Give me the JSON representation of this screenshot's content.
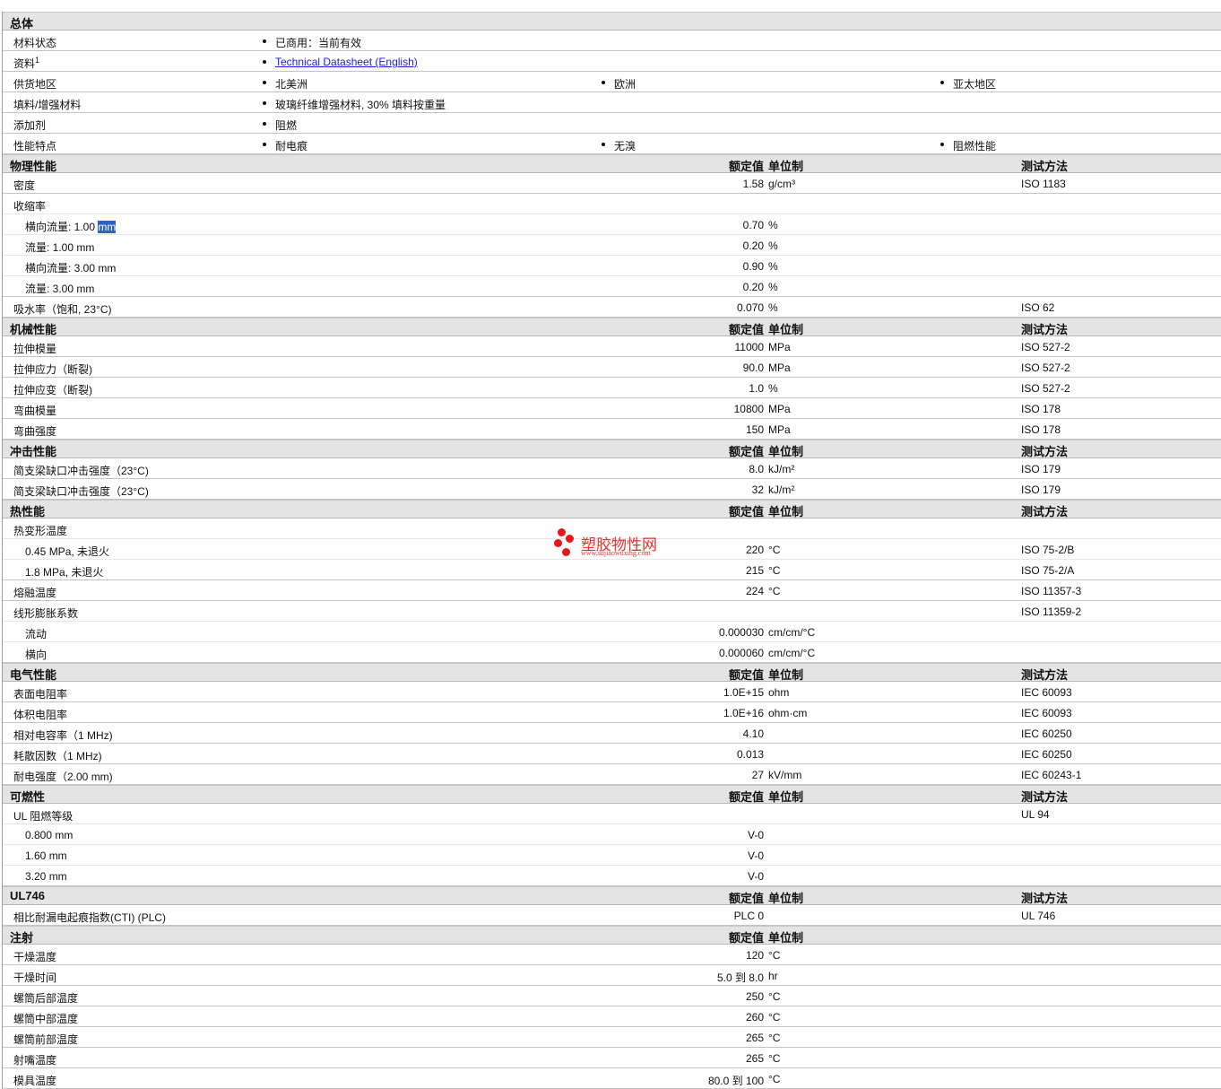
{
  "columns": {
    "value": "额定值",
    "unit": "单位制",
    "method": "测试方法"
  },
  "general": {
    "title": "总体",
    "rows": [
      {
        "label": "材料状态",
        "items": [
          "已商用：当前有效"
        ]
      },
      {
        "label": "资料",
        "sup": "1",
        "items": [
          "Technical Datasheet (English)"
        ],
        "link": true
      },
      {
        "label": "供货地区",
        "items": [
          "北美洲",
          "欧洲",
          "亚太地区"
        ]
      },
      {
        "label": "填料/增强材料",
        "items": [
          "玻璃纤维增强材料, 30% 填料按重量"
        ]
      },
      {
        "label": "添加剂",
        "items": [
          "阻燃"
        ]
      },
      {
        "label": "性能特点",
        "items": [
          "耐电痕",
          "无溴",
          "阻燃性能"
        ]
      }
    ]
  },
  "sections": [
    {
      "title": "物理性能",
      "method_header": true,
      "rows": [
        {
          "label": "密度",
          "value": "1.58",
          "unit": "g/cm³",
          "method": "ISO 1183"
        },
        {
          "label": "收缩率",
          "value": "",
          "unit": "",
          "method": "",
          "parent": true
        },
        {
          "label": "横向流量: 1.00 ",
          "hl": "mm",
          "value": "0.70",
          "unit": "%",
          "method": "",
          "indent": true
        },
        {
          "label": "流量: 1.00 mm",
          "value": "0.20",
          "unit": "%",
          "method": "",
          "indent": true
        },
        {
          "label": "横向流量: 3.00 mm",
          "value": "0.90",
          "unit": "%",
          "method": "",
          "indent": true
        },
        {
          "label": "流量: 3.00 mm",
          "value": "0.20",
          "unit": "%",
          "method": "",
          "indent": true,
          "last": true
        },
        {
          "label": "吸水率（饱和, 23°C)",
          "value": "0.070",
          "unit": "%",
          "method": "ISO 62"
        }
      ]
    },
    {
      "title": "机械性能",
      "method_header": true,
      "rows": [
        {
          "label": "拉伸模量",
          "value": "11000",
          "unit": "MPa",
          "method": "ISO 527-2"
        },
        {
          "label": "拉伸应力（断裂)",
          "value": "90.0",
          "unit": "MPa",
          "method": "ISO 527-2"
        },
        {
          "label": "拉伸应变（断裂)",
          "value": "1.0",
          "unit": "%",
          "method": "ISO 527-2"
        },
        {
          "label": "弯曲模量",
          "value": "10800",
          "unit": "MPa",
          "method": "ISO 178"
        },
        {
          "label": "弯曲强度",
          "value": "150",
          "unit": "MPa",
          "method": "ISO 178"
        }
      ]
    },
    {
      "title": "冲击性能",
      "method_header": true,
      "rows": [
        {
          "label": "简支梁缺口冲击强度（23°C)",
          "value": "8.0",
          "unit": "kJ/m²",
          "method": "ISO 179"
        },
        {
          "label": "简支梁缺口冲击强度（23°C)",
          "value": "32",
          "unit": "kJ/m²",
          "method": "ISO 179"
        }
      ]
    },
    {
      "title": "热性能",
      "method_header": true,
      "rows": [
        {
          "label": "热变形温度",
          "value": "",
          "unit": "",
          "method": "",
          "parent": true
        },
        {
          "label": "0.45 MPa, 未退火",
          "value": "220",
          "unit": "°C",
          "method": "ISO 75-2/B",
          "indent": true
        },
        {
          "label": "1.8 MPa, 未退火",
          "value": "215",
          "unit": "°C",
          "method": "ISO 75-2/A",
          "indent": true,
          "last": true
        },
        {
          "label": "熔融温度",
          "value": "224",
          "unit": "°C",
          "method": "ISO 11357-3"
        },
        {
          "label": "线形膨胀系数",
          "value": "",
          "unit": "",
          "method": "ISO 11359-2",
          "parent": true
        },
        {
          "label": "流动",
          "value": "0.000030",
          "unit": "cm/cm/°C",
          "method": "",
          "indent": true
        },
        {
          "label": "横向",
          "value": "0.000060",
          "unit": "cm/cm/°C",
          "method": "",
          "indent": true,
          "last": true
        }
      ]
    },
    {
      "title": "电气性能",
      "method_header": true,
      "rows": [
        {
          "label": "表面电阻率",
          "value": "1.0E+15",
          "unit": "ohm",
          "method": "IEC 60093"
        },
        {
          "label": "体积电阻率",
          "value": "1.0E+16",
          "unit": "ohm·cm",
          "method": "IEC 60093"
        },
        {
          "label": "相对电容率（1 MHz)",
          "value": "4.10",
          "unit": "",
          "method": "IEC 60250"
        },
        {
          "label": "耗散因数（1 MHz)",
          "value": "0.013",
          "unit": "",
          "method": "IEC 60250"
        },
        {
          "label": "耐电强度（2.00 mm)",
          "value": "27",
          "unit": "kV/mm",
          "method": "IEC 60243-1"
        }
      ]
    },
    {
      "title": "可燃性",
      "method_header": true,
      "rows": [
        {
          "label": "UL 阻燃等级",
          "value": "",
          "unit": "",
          "method": "UL 94",
          "parent": true
        },
        {
          "label": "0.800 mm",
          "value": "V-0",
          "unit": "",
          "method": "",
          "indent": true
        },
        {
          "label": "1.60 mm",
          "value": "V-0",
          "unit": "",
          "method": "",
          "indent": true
        },
        {
          "label": "3.20 mm",
          "value": "V-0",
          "unit": "",
          "method": "",
          "indent": true,
          "last": true
        }
      ]
    },
    {
      "title": "UL746",
      "method_header": true,
      "rows": [
        {
          "label": "相比耐漏电起痕指数(CTI) (PLC)",
          "value": "PLC 0",
          "unit": "",
          "method": "UL 746"
        }
      ]
    },
    {
      "title": "注射",
      "method_header": false,
      "rows": [
        {
          "label": "干燥温度",
          "value": "120",
          "unit": "°C",
          "method": ""
        },
        {
          "label": "干燥时间",
          "value": "5.0 到  8.0",
          "unit": "hr",
          "method": ""
        },
        {
          "label": "螺筒后部温度",
          "value": "250",
          "unit": "°C",
          "method": ""
        },
        {
          "label": "螺筒中部温度",
          "value": "260",
          "unit": "°C",
          "method": ""
        },
        {
          "label": "螺筒前部温度",
          "value": "265",
          "unit": "°C",
          "method": ""
        },
        {
          "label": "射嘴温度",
          "value": "265",
          "unit": "°C",
          "method": ""
        },
        {
          "label": "模具温度",
          "value": "80.0 到  100",
          "unit": "°C",
          "method": ""
        }
      ]
    }
  ],
  "watermark": {
    "title": "塑胶物性网",
    "url": "www.sujiaowuxing.com",
    "color": "#e81818"
  }
}
